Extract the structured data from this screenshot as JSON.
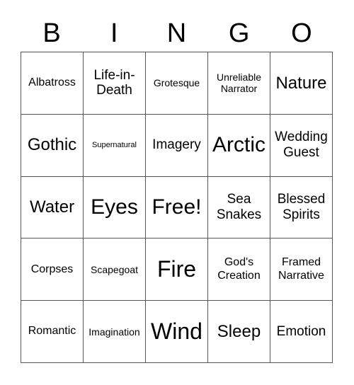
{
  "header": [
    "B",
    "I",
    "N",
    "G",
    "O"
  ],
  "cells": [
    [
      {
        "text": "Albatross",
        "size": "md"
      },
      {
        "text": "Life-in-Death",
        "size": "lg"
      },
      {
        "text": "Grotesque",
        "size": "sm"
      },
      {
        "text": "Unreliable Narrator",
        "size": "sm"
      },
      {
        "text": "Nature",
        "size": "xl"
      }
    ],
    [
      {
        "text": "Gothic",
        "size": "xl"
      },
      {
        "text": "Supernatural",
        "size": "xs"
      },
      {
        "text": "Imagery",
        "size": "lg"
      },
      {
        "text": "Arctic",
        "size": "xxl"
      },
      {
        "text": "Wedding Guest",
        "size": "lg"
      }
    ],
    [
      {
        "text": "Water",
        "size": "xl"
      },
      {
        "text": "Eyes",
        "size": "xxl"
      },
      {
        "text": "Free!",
        "size": "xxl"
      },
      {
        "text": "Sea Snakes",
        "size": "lg"
      },
      {
        "text": "Blessed Spirits",
        "size": "lg"
      }
    ],
    [
      {
        "text": "Corpses",
        "size": "md"
      },
      {
        "text": "Scapegoat",
        "size": "sm"
      },
      {
        "text": "Fire",
        "size": "big"
      },
      {
        "text": "God's Creation",
        "size": "md"
      },
      {
        "text": "Framed Narrative",
        "size": "md"
      }
    ],
    [
      {
        "text": "Romantic",
        "size": "md"
      },
      {
        "text": "Imagination",
        "size": "sm"
      },
      {
        "text": "Wind",
        "size": "big"
      },
      {
        "text": "Sleep",
        "size": "xl"
      },
      {
        "text": "Emotion",
        "size": "lg"
      }
    ]
  ]
}
